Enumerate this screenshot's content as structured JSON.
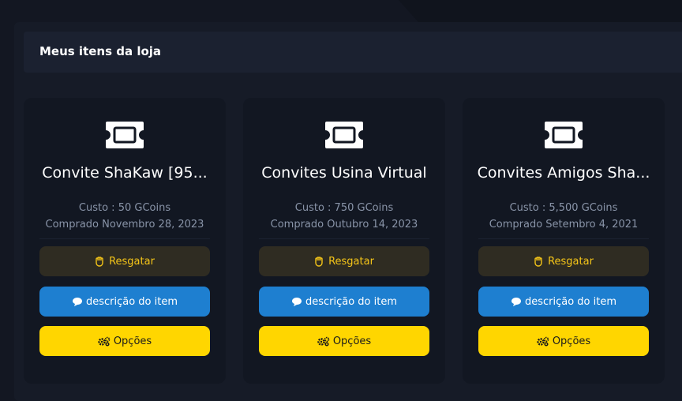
{
  "panel": {
    "title": "Meus itens da loja"
  },
  "colors": {
    "background": "#131722",
    "card": "#121722",
    "redeem_bg": "#2f2c22",
    "redeem_text": "#f5c518",
    "description_bg": "#1e7fd0",
    "options_bg": "#ffd600"
  },
  "items": [
    {
      "icon": "ticket-icon",
      "name": "Convite ShaKaw [95...",
      "cost": "Custo : 50 GCoins",
      "purchased": "Comprado Novembro 28, 2023",
      "redeem_label": "Resgatar",
      "description_label": "descrição do item",
      "options_label": "Opções"
    },
    {
      "icon": "ticket-icon",
      "name": "Convites Usina Virtual",
      "cost": "Custo : 750 GCoins",
      "purchased": "Comprado Outubro 14, 2023",
      "redeem_label": "Resgatar",
      "description_label": "descrição do item",
      "options_label": "Opções"
    },
    {
      "icon": "ticket-icon",
      "name": "Convites Amigos Sha...",
      "cost": "Custo : 5,500 GCoins",
      "purchased": "Comprado Setembro 4, 2021",
      "redeem_label": "Resgatar",
      "description_label": "descrição do item",
      "options_label": "Opções"
    }
  ]
}
